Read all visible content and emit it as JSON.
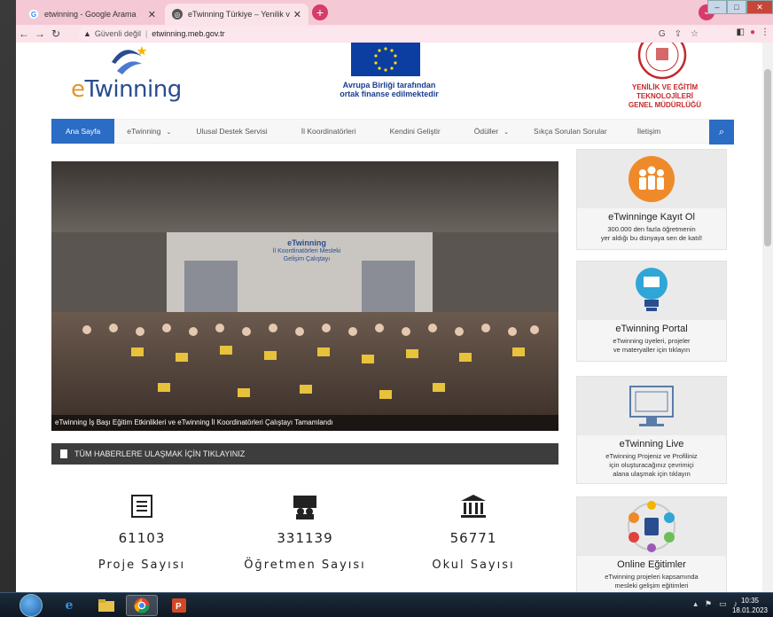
{
  "browser": {
    "tabs": [
      {
        "title": "etwinning - Google Arama",
        "favicon": "google-icon"
      },
      {
        "title": "eTwinning Türkiye – Yenilik ve Eğ",
        "favicon": "etwinning-icon"
      }
    ],
    "new_tab": "+",
    "security_label": "Güvenli değil",
    "url": "etwinning.meb.gov.tr"
  },
  "header": {
    "logo_prefix": "e",
    "logo_text": "Twinning",
    "eu_text_line1": "Avrupa Birliği tarafından",
    "eu_text_line2": "ortak finanse edilmektedir",
    "meb_line1": "YENİLİK VE EĞİTİM TEKNOLOJİLERİ",
    "meb_line2": "GENEL MÜDÜRLÜĞÜ"
  },
  "menu": {
    "items": [
      {
        "label": "Ana Sayfa",
        "active": true
      },
      {
        "label": "eTwinning",
        "dropdown": true
      },
      {
        "label": "Ulusal Destek Servisi"
      },
      {
        "label": "İl Koordinatörleri"
      },
      {
        "label": "Kendini Geliştir"
      },
      {
        "label": "Ödüller",
        "dropdown": true
      },
      {
        "label": "Sıkça Sorulan Sorular"
      },
      {
        "label": "İletişim"
      }
    ]
  },
  "slider": {
    "caption": "eTwinning İş Başı Eğitim Etkinlikleri ve eTwinning İl Koordinatörleri Çalıştayı Tamamlandı",
    "banner_title": "eTwinning",
    "banner_sub": "İl Koordinatörleri Mesleki Gelişim Çalıştayı"
  },
  "news_bar": {
    "label": "TÜM HABERLERE ULAŞMAK İÇİN TIKLAYINIZ"
  },
  "stats": [
    {
      "value": "61103",
      "label": "Proje Sayısı",
      "icon": "document-icon"
    },
    {
      "value": "331139",
      "label": "Öğretmen Sayısı",
      "icon": "teacher-icon"
    },
    {
      "value": "56771",
      "label": "Okul Sayısı",
      "icon": "school-icon"
    }
  ],
  "cards": [
    {
      "title": "eTwinninge Kayıt Ol",
      "desc1": "300.000 den fazla öğretmenin",
      "desc2": "yer aldığı bu dünyaya sen de katıl!",
      "desc3": ""
    },
    {
      "title": "eTwinning Portal",
      "desc1": "eTwinning üyeleri, projeler",
      "desc2": "ve materyaller için tıklayın",
      "desc3": ""
    },
    {
      "title": "eTwinning Live",
      "desc1": "eTwinning Projeniz ve Profiliniz",
      "desc2": "için oluşturacağınız çevrimiçi",
      "desc3": "alana ulaşmak için tıklayın"
    },
    {
      "title": "Online Eğitimler",
      "desc1": "eTwinning projeleri kapsamında",
      "desc2": "mesleki gelişim eğitimleri",
      "desc3": ""
    }
  ],
  "taskbar": {
    "time": "10:35",
    "date": "18.01.2023"
  },
  "colors": {
    "accent": "#2b6cc4",
    "tab_bar": "#f4c8d4",
    "meb_red": "#c2282b",
    "logo_blue": "#2a4d8f"
  }
}
